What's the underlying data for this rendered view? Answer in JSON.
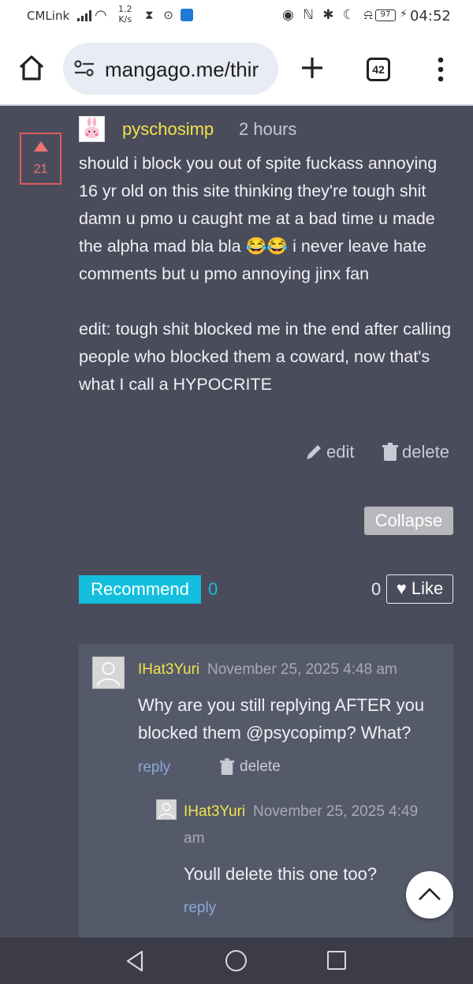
{
  "status_bar": {
    "carrier": "CMLink",
    "speed_value": "1.2",
    "speed_unit": "K/s",
    "battery": "97",
    "time": "04:52"
  },
  "browser": {
    "url": "mangago.me/thir",
    "tab_count": "42"
  },
  "comment": {
    "votes": "21",
    "username": "pyschosimp",
    "time_ago": "2 hours",
    "text": "should i block you out of spite fuckass annoying 16 yr old on this site thinking they're tough shit damn u pmo u caught me at a bad time u made the alpha mad bla bla 😂😂 i never leave hate comments but u pmo annoying jinx fan\n\nedit: tough shit blocked me in the end after calling people who blocked them a coward, now that's what I call a HYPOCRITE",
    "edit_label": "edit",
    "delete_label": "delete",
    "collapse_label": "Collapse",
    "recommend_label": "Recommend",
    "recommend_count": "0",
    "like_count": "0",
    "like_label": "Like"
  },
  "replies": [
    {
      "username": "IHat3Yuri",
      "date": "November 25, 2025 4:48 am",
      "text": "Why are you still replying AFTER you blocked them @psycopimp? What?",
      "reply_label": "reply",
      "delete_label": "delete"
    },
    {
      "username": "IHat3Yuri",
      "date": "November 25, 2025 4:49",
      "date_cont": "am",
      "text": "Youll delete this one too?",
      "reply_label": "reply"
    }
  ],
  "colors": {
    "page_bg": "#4a4c5c",
    "username": "#f2e24a",
    "vote_accent": "#f07272",
    "recommend": "#13bfdc",
    "reply_link": "#8aa8d8"
  }
}
